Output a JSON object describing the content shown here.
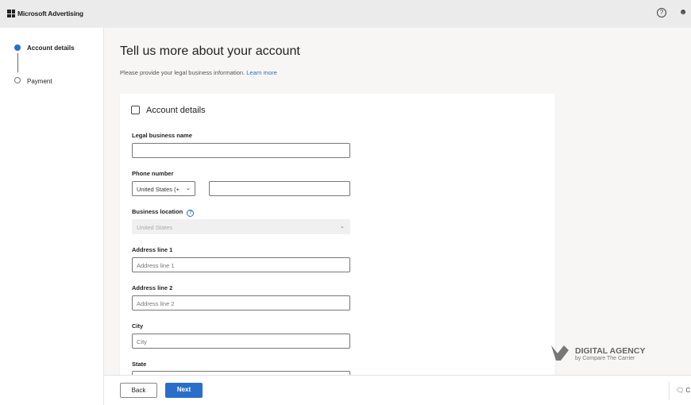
{
  "header": {
    "brand": "Microsoft Advertising",
    "icons": [
      "help-icon",
      "user-icon"
    ]
  },
  "steps": [
    {
      "label": "Account details",
      "active": true
    },
    {
      "label": "Payment",
      "active": false
    }
  ],
  "page": {
    "title": "Tell us more about your account",
    "subtitle": "Please provide your legal business information.",
    "learn_more": "Learn more"
  },
  "card": {
    "title": "Account details",
    "legal_name": {
      "label": "Legal business name",
      "value": ""
    },
    "phone": {
      "label": "Phone number",
      "country": "United States (+",
      "value": ""
    },
    "location": {
      "label": "Business location",
      "value": "United States"
    },
    "address1": {
      "label": "Address line 1",
      "placeholder": "Address line 1"
    },
    "address2": {
      "label": "Address line 2",
      "placeholder": "Address line 2"
    },
    "city": {
      "label": "City",
      "placeholder": "City"
    },
    "state": {
      "label": "State"
    }
  },
  "footer": {
    "back": "Back",
    "next": "Next",
    "chat": "C"
  },
  "watermark": {
    "title": "DIGITAL AGENCY",
    "sub": "by Compare The Carrier"
  },
  "colors": {
    "accent": "#2b6ec9"
  }
}
